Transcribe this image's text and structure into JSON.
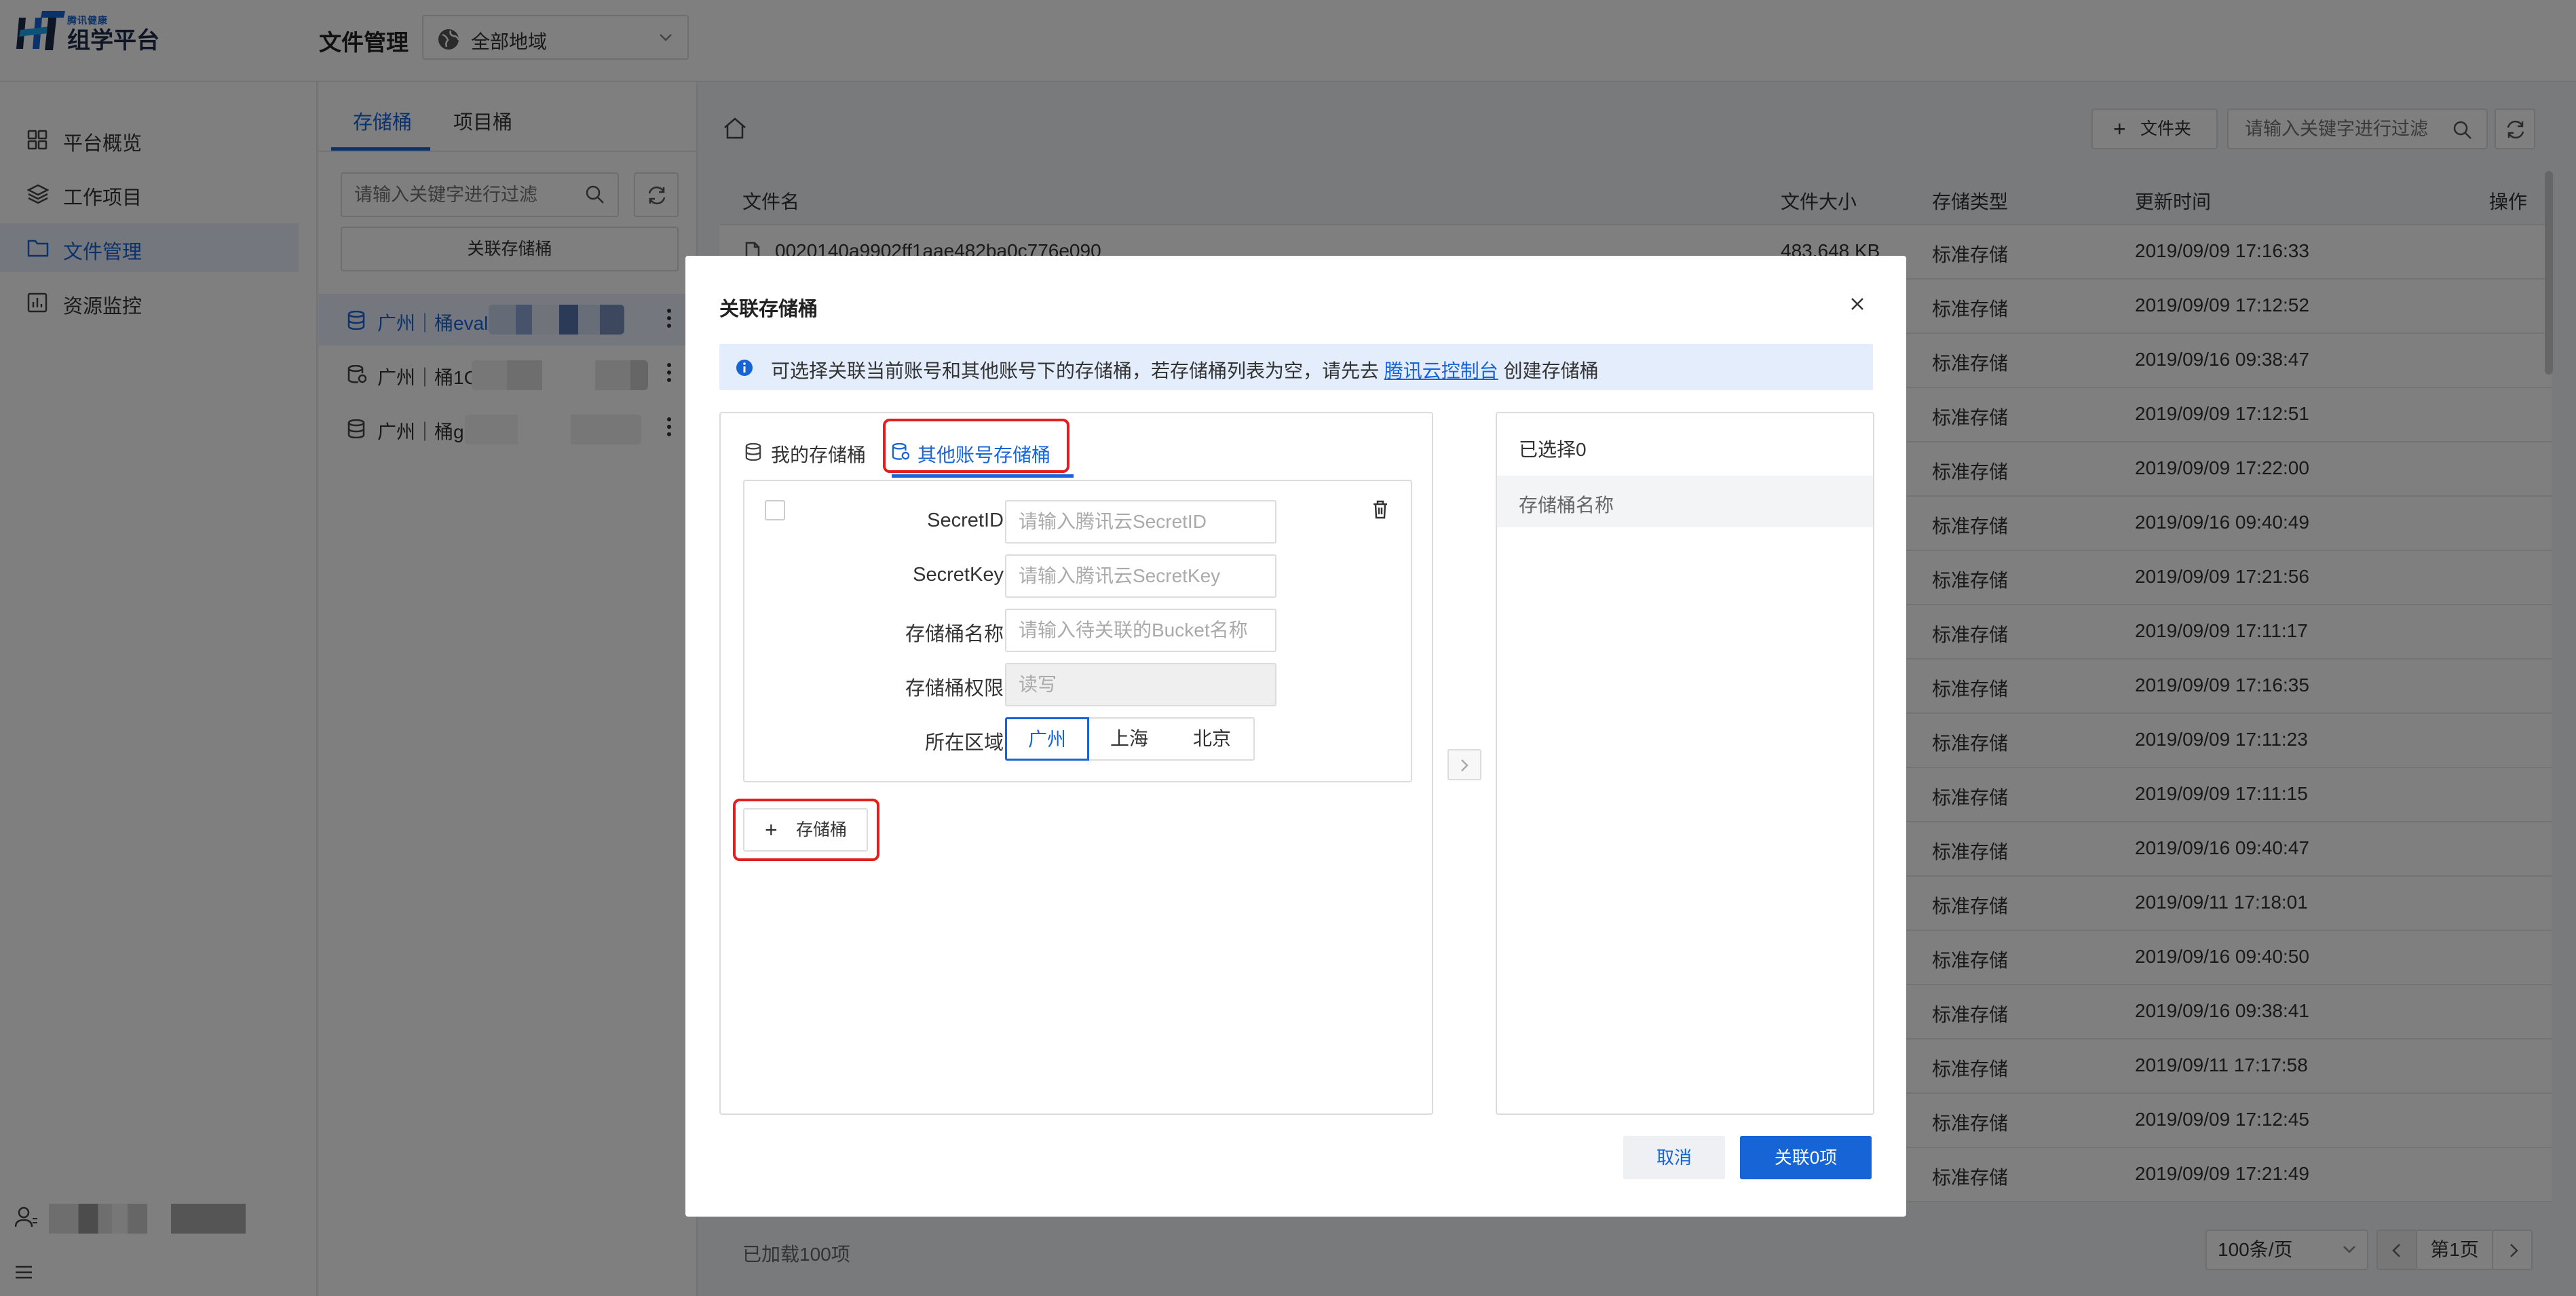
{
  "header": {
    "logo_small": "腾讯健康",
    "logo_text": "组学平台",
    "page_title": "文件管理",
    "region_selector": "全部地域"
  },
  "nav": {
    "items": [
      {
        "label": "平台概览",
        "icon": "grid-icon"
      },
      {
        "label": "工作项目",
        "icon": "layers-icon"
      },
      {
        "label": "文件管理",
        "icon": "folder-icon",
        "active": true
      },
      {
        "label": "资源监控",
        "icon": "chart-icon"
      }
    ]
  },
  "bucket_panel": {
    "tabs": [
      "存储桶",
      "项目桶"
    ],
    "search_placeholder": "请输入关键字进行过滤",
    "link_button": "关联存储桶",
    "buckets": [
      {
        "label": "广州｜桶eval-",
        "active": true
      },
      {
        "label": "广州｜桶1C"
      },
      {
        "label": "广州｜桶g"
      }
    ]
  },
  "files": {
    "new_folder": "文件夹",
    "search_placeholder": "请输入关键字进行过滤",
    "columns": [
      "文件名",
      "文件大小",
      "存储类型",
      "更新时间",
      "操作"
    ],
    "rows": [
      {
        "name": "0020140a9902ff1aae482ba0c776e090",
        "size": "483.648 KB",
        "type": "标准存储",
        "time": "2019/09/09 17:16:33"
      },
      {
        "name": "",
        "size": "",
        "type": "标准存储",
        "time": "2019/09/09 17:12:52"
      },
      {
        "name": "",
        "size": "",
        "type": "标准存储",
        "time": "2019/09/16 09:38:47"
      },
      {
        "name": "",
        "size": "",
        "type": "标准存储",
        "time": "2019/09/09 17:12:51"
      },
      {
        "name": "",
        "size": "",
        "type": "标准存储",
        "time": "2019/09/09 17:22:00"
      },
      {
        "name": "",
        "size": "",
        "type": "标准存储",
        "time": "2019/09/16 09:40:49"
      },
      {
        "name": "",
        "size": "",
        "type": "标准存储",
        "time": "2019/09/09 17:21:56"
      },
      {
        "name": "",
        "size": "",
        "type": "标准存储",
        "time": "2019/09/09 17:11:17"
      },
      {
        "name": "",
        "size": "",
        "type": "标准存储",
        "time": "2019/09/09 17:16:35"
      },
      {
        "name": "",
        "size": "",
        "type": "标准存储",
        "time": "2019/09/09 17:11:23"
      },
      {
        "name": "",
        "size": "",
        "type": "标准存储",
        "time": "2019/09/09 17:11:15"
      },
      {
        "name": "",
        "size": "",
        "type": "标准存储",
        "time": "2019/09/16 09:40:47"
      },
      {
        "name": "",
        "size": "",
        "type": "标准存储",
        "time": "2019/09/11 17:18:01"
      },
      {
        "name": "",
        "size": "",
        "type": "标准存储",
        "time": "2019/09/16 09:40:50"
      },
      {
        "name": "",
        "size": "",
        "type": "标准存储",
        "time": "2019/09/16 09:38:41"
      },
      {
        "name": "",
        "size": "",
        "type": "标准存储",
        "time": "2019/09/11 17:17:58"
      },
      {
        "name": "",
        "size": "",
        "type": "标准存储",
        "time": "2019/09/09 17:12:45"
      },
      {
        "name": "",
        "size": "",
        "type": "标准存储",
        "time": "2019/09/09 17:21:49"
      }
    ],
    "loaded": "已加载100项",
    "page_size": "100条/页",
    "page": "第1页"
  },
  "modal": {
    "title": "关联存储桶",
    "info_prefix": "可选择关联当前账号和其他账号下的存储桶，若存储桶列表为空，请先去",
    "info_link": "腾讯云控制台",
    "info_suffix": "创建存储桶",
    "tabs": [
      "我的存储桶",
      "其他账号存储桶"
    ],
    "form": {
      "secret_id_label": "SecretID:",
      "secret_id_placeholder": "请输入腾讯云SecretID",
      "secret_key_label": "SecretKey:",
      "secret_key_placeholder": "请输入腾讯云SecretKey",
      "bucket_name_label": "存储桶名称:",
      "bucket_name_placeholder": "请输入待关联的Bucket名称",
      "permission_label": "存储桶权限:",
      "permission_value": "读写",
      "region_label": "所在区域:",
      "regions": [
        "广州",
        "上海",
        "北京"
      ],
      "selected_region": "广州"
    },
    "add_bucket": "存储桶",
    "selected_count": "已选择0",
    "selected_header": "存储桶名称",
    "cancel": "取消",
    "confirm": "关联0项"
  },
  "colors": {
    "primary": "#1664d6",
    "highlight": "#e02020",
    "info_bg": "#e3edfc"
  }
}
